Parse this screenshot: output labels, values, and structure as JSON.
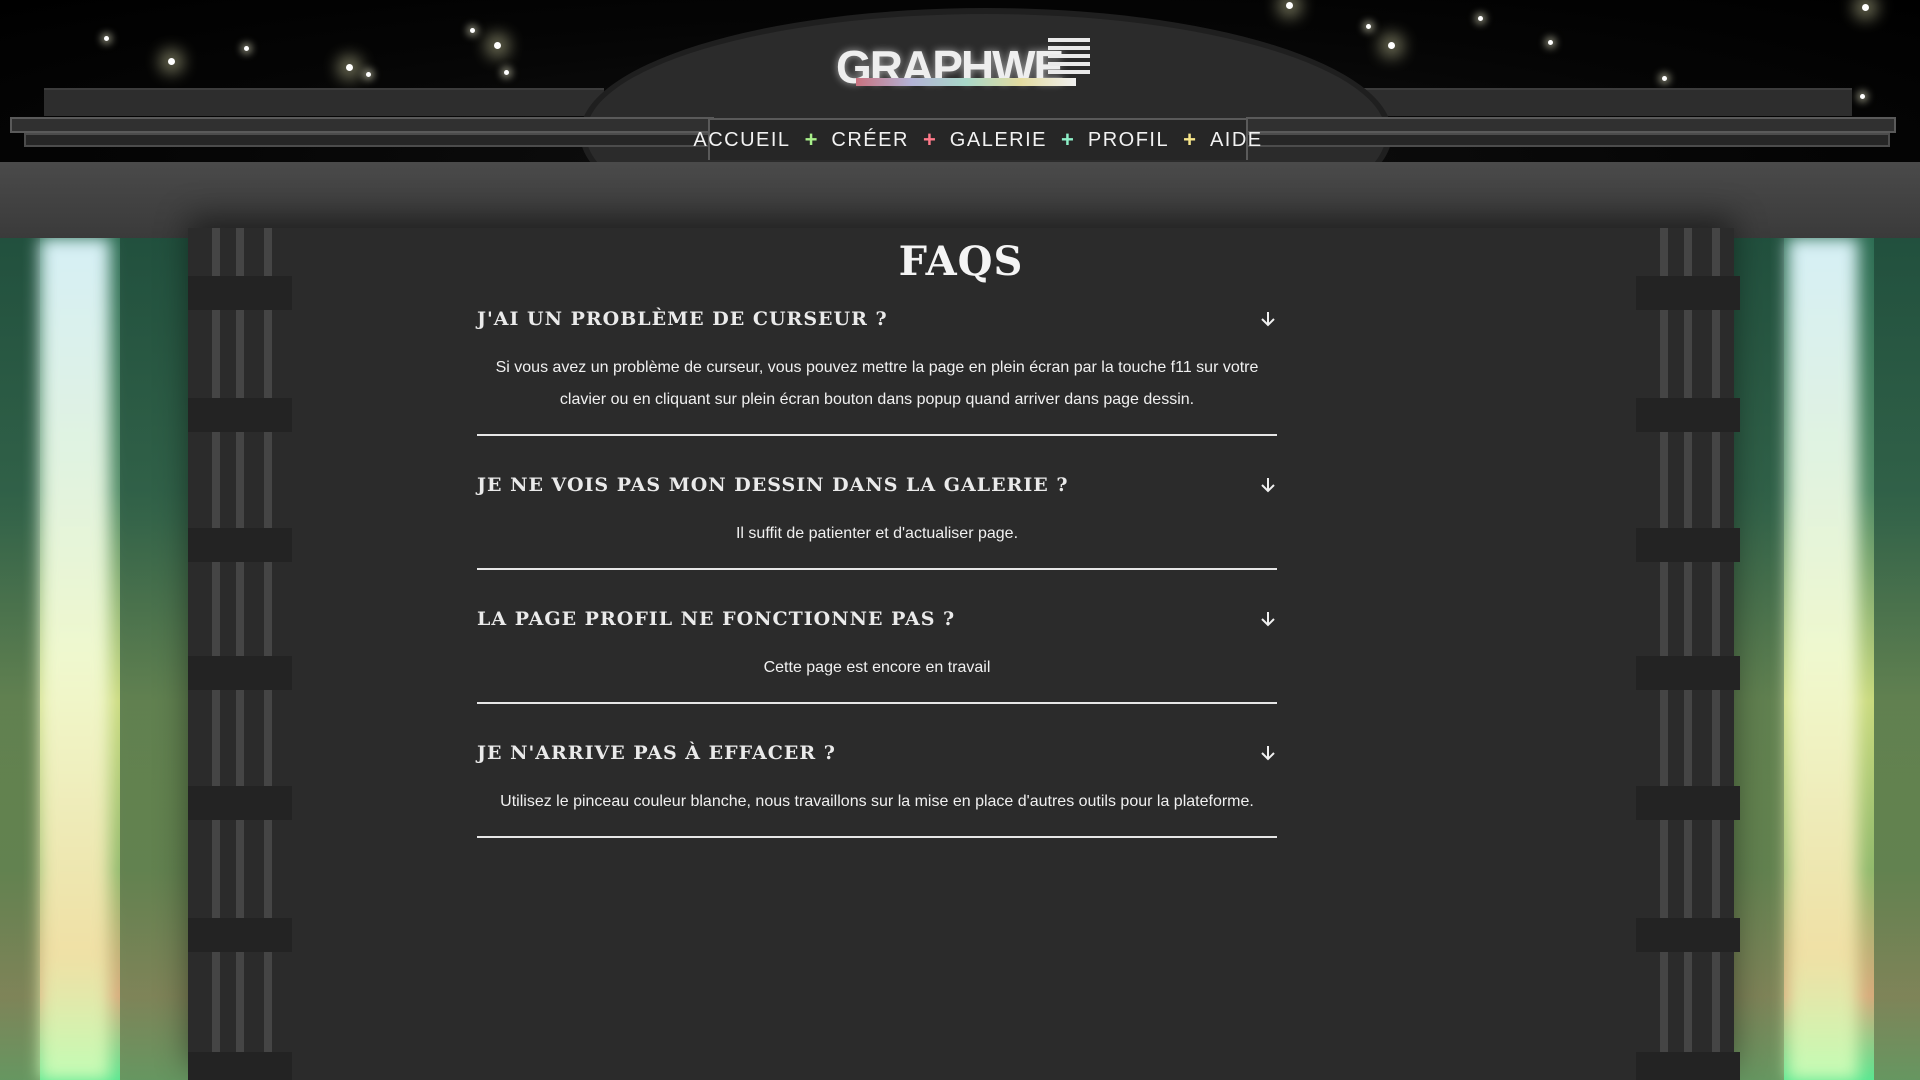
{
  "header": {
    "logo_text": "GRAPHWE",
    "nav": [
      {
        "label": "ACCUEIL"
      },
      {
        "label": "CRÉER"
      },
      {
        "label": "GALERIE"
      },
      {
        "label": "PROFIL"
      },
      {
        "label": "AIDE"
      }
    ],
    "separator": "+",
    "separator_colors": [
      "#a8f08a",
      "#ff7a8a",
      "#8ef0c8",
      "#f6e58a"
    ]
  },
  "faq": {
    "title": "FAQS",
    "items": [
      {
        "question": "J'ai un problème de curseur ?",
        "answer": "Si vous avez un problème de curseur, vous pouvez mettre la page en plein écran par la touche f11 sur votre clavier ou en cliquant sur plein écran bouton dans popup quand arriver dans page dessin."
      },
      {
        "question": "Je ne vois pas mon dessin dans la galerie ?",
        "answer": "Il suffit de patienter et d'actualiser page."
      },
      {
        "question": "La page profil ne fonctionne pas ?",
        "answer": "Cette page est encore en travail"
      },
      {
        "question": "Je n'arrive pas à effacer ?",
        "answer": "Utilisez le pinceau couleur blanche, nous travaillons sur la mise en place d'autres outils pour la plateforme."
      }
    ],
    "expand_icon": "arrow-down-icon"
  },
  "colors": {
    "background": "#2b2b2b",
    "text": "#f0f0f0",
    "divider": "#e6e6e6"
  }
}
